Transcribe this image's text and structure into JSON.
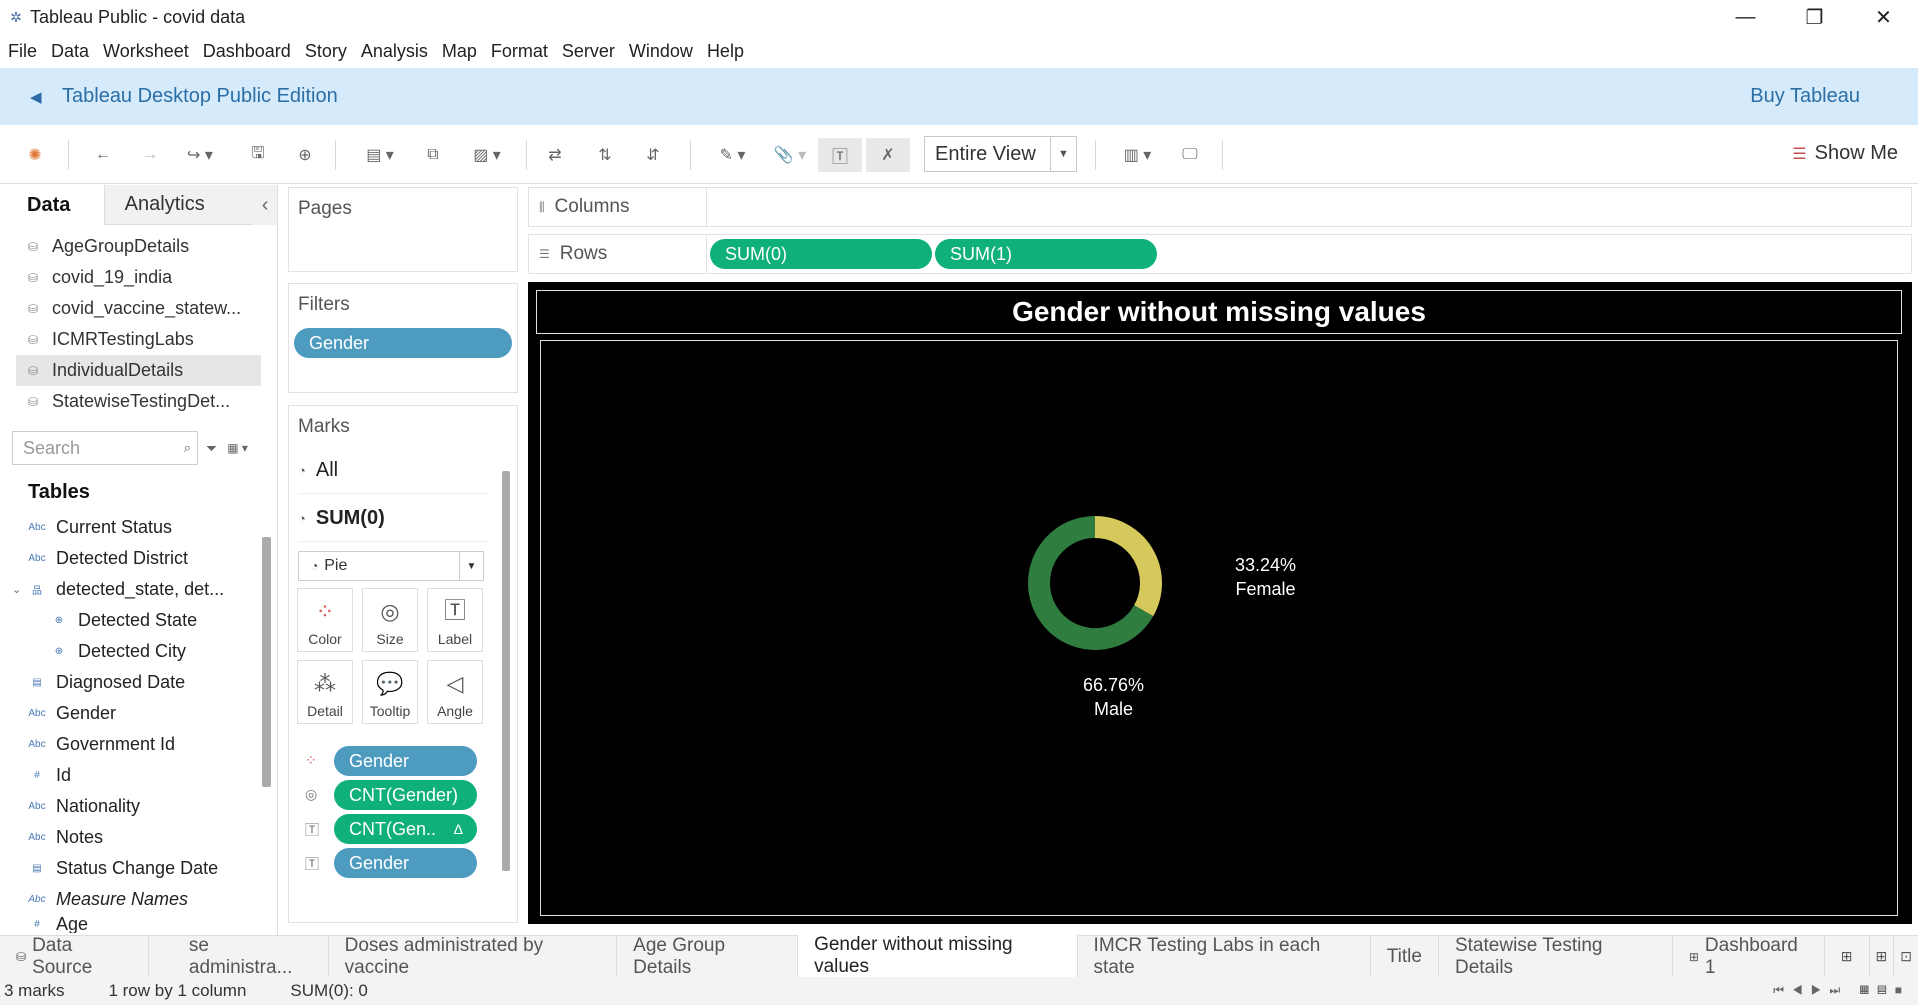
{
  "window": {
    "title": "Tableau Public - covid data",
    "minimize": "—",
    "restore": "❐",
    "close": "✕"
  },
  "menu": [
    "File",
    "Data",
    "Worksheet",
    "Dashboard",
    "Story",
    "Analysis",
    "Map",
    "Format",
    "Server",
    "Window",
    "Help"
  ],
  "banner": {
    "text": "Tableau Desktop Public Edition",
    "buy": "Buy Tableau"
  },
  "toolbar": {
    "view_mode": "Entire View",
    "show_me": "Show Me"
  },
  "left_pane": {
    "tab_data": "Data",
    "tab_analytics": "Analytics",
    "collapse": "‹",
    "data_sources": [
      "AgeGroupDetails",
      "covid_19_india",
      "covid_vaccine_statew...",
      "ICMRTestingLabs",
      "IndividualDetails",
      "StatewiseTestingDet..."
    ],
    "selected_source": "IndividualDetails",
    "search_placeholder": "Search",
    "tables_heading": "Tables",
    "fields": [
      {
        "name": "Current Status",
        "icon": "Abc"
      },
      {
        "name": "Detected District",
        "icon": "Abc"
      },
      {
        "name": "detected_state, det...",
        "icon": "hierarchy"
      },
      {
        "name": "Detected State",
        "icon": "globe"
      },
      {
        "name": "Detected City",
        "icon": "globe"
      },
      {
        "name": "Diagnosed Date",
        "icon": "calendar"
      },
      {
        "name": "Gender",
        "icon": "Abc"
      },
      {
        "name": "Government Id",
        "icon": "Abc"
      },
      {
        "name": "Id",
        "icon": "#"
      },
      {
        "name": "Nationality",
        "icon": "Abc"
      },
      {
        "name": "Notes",
        "icon": "Abc"
      },
      {
        "name": "Status Change Date",
        "icon": "calendar"
      },
      {
        "name": "Measure Names",
        "icon": "Abc"
      },
      {
        "name": "Age",
        "icon": "#"
      }
    ]
  },
  "cards": {
    "pages": "Pages",
    "filters": "Filters",
    "filter_pill": "Gender",
    "marks": "Marks",
    "marks_all": "All",
    "marks_sum": "SUM(0)",
    "mark_type": "Pie",
    "buttons": [
      "Color",
      "Size",
      "Label",
      "Detail",
      "Tooltip",
      "Angle"
    ],
    "mark_pills": [
      "Gender",
      "CNT(Gender)",
      "CNT(Gen..",
      "Gender"
    ],
    "delta": "Δ"
  },
  "shelves": {
    "columns": "Columns",
    "rows": "Rows",
    "row_pills": [
      "SUM(0)",
      "SUM(1)"
    ]
  },
  "view": {
    "title": "Gender without missing values",
    "female_pct": "33.24%",
    "female": "Female",
    "male_pct": "66.76%",
    "male": "Male"
  },
  "chart_data": {
    "type": "pie",
    "title": "Gender without missing values",
    "categories": [
      "Female",
      "Male"
    ],
    "values": [
      33.24,
      66.76
    ],
    "colors": [
      "#d4c95a",
      "#2f7d3f"
    ]
  },
  "sheet_tabs": [
    "Data Source",
    "se administra...",
    "Doses administrated by vaccine",
    "Age Group Details",
    "Gender without missing values",
    "IMCR Testing Labs in each state",
    "Title",
    "Statewise Testing Details",
    "Dashboard 1"
  ],
  "active_tab": "Gender without missing values",
  "status": {
    "marks": "3 marks",
    "rows": "1 row by 1 column",
    "sum": "SUM(0): 0"
  }
}
